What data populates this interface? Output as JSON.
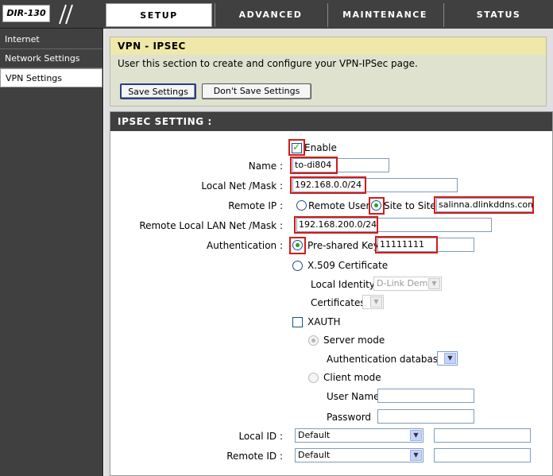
{
  "header": {
    "logo": "DIR-130",
    "tabs": [
      "SETUP",
      "ADVANCED",
      "MAINTENANCE",
      "STATUS"
    ]
  },
  "sidebar": {
    "items": [
      {
        "label": "Internet"
      },
      {
        "label": "Network Settings"
      },
      {
        "label": "VPN Settings"
      }
    ]
  },
  "vpn": {
    "title": "VPN - IPSEC",
    "description": "User this section to create and configure your VPN-IPSec page.",
    "save_label": "Save Settings",
    "dont_save_label": "Don't Save Settings"
  },
  "ipsec": {
    "heading": "IPSEC SETTING :",
    "enable_label": "Enable",
    "name_label": "Name :",
    "name_value": "to-di804",
    "local_net_label": "Local Net /Mask :",
    "local_net_value": "192.168.0.0/24",
    "remote_ip_label": "Remote IP :",
    "remote_user_label": "Remote User",
    "site_to_site_label": "Site to Site",
    "remote_host_value": "salinna.dlinkddns.com",
    "remote_lan_label": "Remote Local LAN Net /Mask :",
    "remote_lan_value": "192.168.200.0/24",
    "auth_label": "Authentication :",
    "psk_label": "Pre-shared Key",
    "psk_value": "11111111",
    "x509_label": "X.509 Certificate",
    "local_identity_label": "Local Identity",
    "local_identity_value": "D-Link Demo",
    "certificates_label": "Certificates",
    "xauth_label": "XAUTH",
    "server_mode_label": "Server mode",
    "auth_db_label": "Authentication database",
    "client_mode_label": "Client mode",
    "username_label": "User Name",
    "password_label": "Password",
    "local_id_label": "Local ID :",
    "local_id_value": "Default",
    "remote_id_label": "Remote ID :",
    "remote_id_value": "Default"
  }
}
